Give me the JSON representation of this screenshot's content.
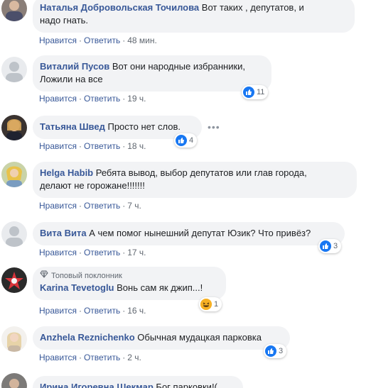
{
  "comments": [
    {
      "author": "Наталья Добровольская Точилова",
      "text": "Вот таких , депутатов, и",
      "text2": "надо гнать.",
      "like": "Нравится",
      "reply": "Ответить",
      "time": "48 мин."
    },
    {
      "author": "Виталий Пусов",
      "text": "Вот они народные избранники,",
      "text2": "Ложили на все",
      "like": "Нравится",
      "reply": "Ответить",
      "time": "19 ч.",
      "reactions": "11"
    },
    {
      "author": "Татьяна Швед",
      "text": "Просто нет слов.",
      "like": "Нравится",
      "reply": "Ответить",
      "time": "18 ч.",
      "reactions": "4"
    },
    {
      "author": "Helga Habib",
      "text": "Ребята вывод, выбор депутатов или глав города,",
      "text2": "делают не горожане!!!!!!!",
      "like": "Нравится",
      "reply": "Ответить",
      "time": "7 ч."
    },
    {
      "author": "Вита Вита",
      "text": "А чем помог нынешний депутат Юзик? Что привёз?",
      "like": "Нравится",
      "reply": "Ответить",
      "time": "17 ч.",
      "reactions": "3"
    },
    {
      "badge": "Топовый поклонник",
      "author": "Karina Tevetoglu",
      "text": "Вонь сам як джип...!",
      "like": "Нравится",
      "reply": "Ответить",
      "time": "16 ч.",
      "reactions": "1"
    },
    {
      "author": "Anzhela Reznichenko",
      "text": "Обычная мудацкая парковка",
      "like": "Нравится",
      "reply": "Ответить",
      "time": "2 ч.",
      "reactions": "3"
    },
    {
      "author": "Ирина Игоревна Шекмар",
      "text": "Бог парковки!("
    }
  ],
  "more_options": "•••",
  "colors": {
    "author": "#385898",
    "bubble": "#f2f3f5",
    "meta": "#606770",
    "like_blue": "#1877f2"
  },
  "icons": {
    "like": "like-icon",
    "haha": "haha-icon",
    "badge": "diamond-icon"
  }
}
